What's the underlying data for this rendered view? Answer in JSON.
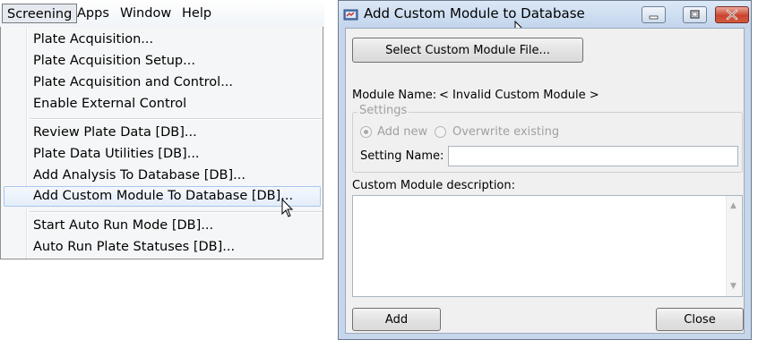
{
  "menubar": {
    "items": [
      "Screening",
      "Apps",
      "Window",
      "Help"
    ]
  },
  "screening_menu": {
    "items": [
      "Plate Acquisition...",
      "Plate Acquisition Setup...",
      "Plate Acquisition and Control...",
      "Enable External Control",
      "Review Plate Data [DB]...",
      "Plate Data Utilities [DB]...",
      "Add Analysis To Database [DB]...",
      "Add Custom Module To Database [DB]...",
      "Start Auto Run Mode [DB]...",
      "Auto Run Plate Statuses [DB]..."
    ],
    "highlighted_index": 7
  },
  "dialog": {
    "title": "Add Custom Module to Database",
    "select_file_button": "Select Custom Module File...",
    "module_name_label": "Module Name:",
    "module_name_value": "< Invalid Custom Module >",
    "settings_group_title": "Settings",
    "radio_add_new": "Add new",
    "radio_overwrite": "Overwrite existing",
    "setting_name_label": "Setting Name:",
    "setting_name_value": "",
    "description_label": "Custom Module description:",
    "description_value": "",
    "add_button": "Add",
    "close_button": "Close"
  },
  "colors": {
    "menu_highlight_border": "#a8c6ee",
    "dialog_frame": "#c6d7ec",
    "close_button": "#c9452f"
  }
}
